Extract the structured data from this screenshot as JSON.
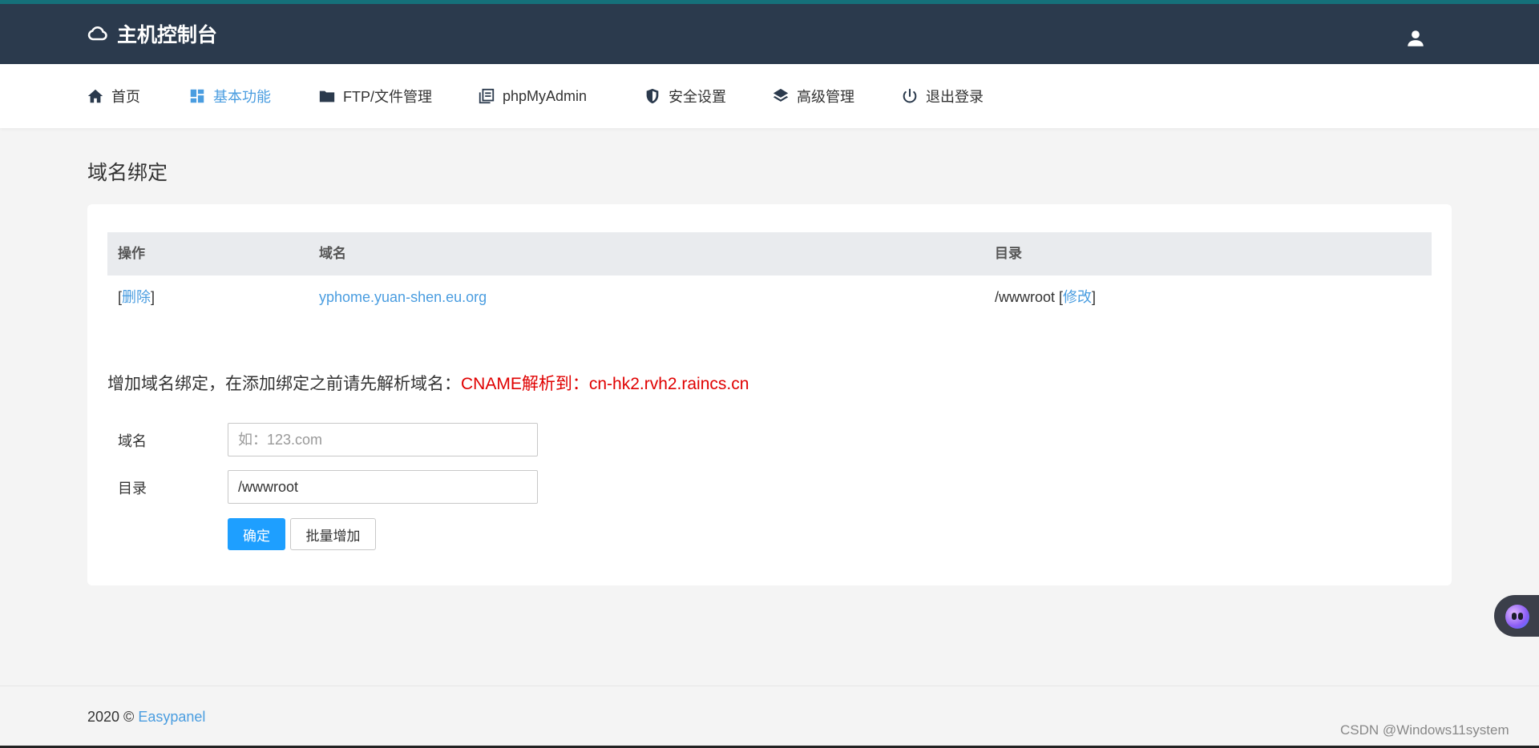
{
  "header": {
    "title": "主机控制台",
    "brand_icon": "cloud-icon",
    "user_icon": "user-icon",
    "bg_color": "#2b3a4d"
  },
  "nav": {
    "items": [
      {
        "label": "首页",
        "icon": "home-icon"
      },
      {
        "label": "基本功能",
        "icon": "dashboard-icon",
        "active": true
      },
      {
        "label": "FTP/文件管理",
        "icon": "folder-icon"
      },
      {
        "label": "phpMyAdmin",
        "icon": "book-icon"
      },
      {
        "label": "安全设置",
        "icon": "shield-icon"
      },
      {
        "label": "高级管理",
        "icon": "layers-icon"
      },
      {
        "label": "退出登录",
        "icon": "power-icon"
      }
    ],
    "active_color": "#4a9de0"
  },
  "page": {
    "title": "域名绑定"
  },
  "table": {
    "headers": [
      "操作",
      "域名",
      "目录"
    ],
    "rows": [
      {
        "action": "删除",
        "domain": "yphome.yuan-shen.eu.org",
        "dir": "/wwwroot",
        "dir_action": "修改"
      }
    ]
  },
  "form": {
    "notice": "增加域名绑定，在添加绑定之前请先解析域名：",
    "notice_highlight": "CNAME解析到：cn-hk2.rvh2.raincs.cn",
    "domain_label": "域名",
    "domain_placeholder": "如：123.com",
    "domain_value": "",
    "dir_label": "目录",
    "dir_value": "/wwwroot",
    "submit_label": "确定",
    "batch_label": "批量增加"
  },
  "footer": {
    "copyright": "2020 ©",
    "brand": "Easypanel"
  },
  "watermark": "CSDN @Windows11system"
}
